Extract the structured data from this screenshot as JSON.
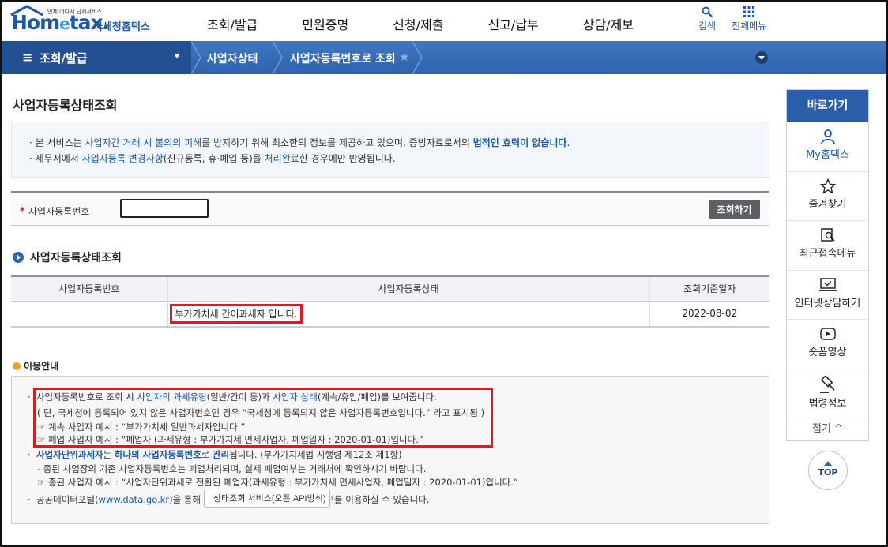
{
  "header": {
    "logo_tagline": "언제 어디서 납세서비스",
    "logo_brand_a": "Hom",
    "logo_brand_e": "e",
    "logo_brand_b": "tax.",
    "logo_korean": "국세청홈택스",
    "gnb": [
      "조회/발급",
      "민원증명",
      "신청/제출",
      "신고/납부",
      "상담/제보"
    ],
    "search_label": "검색",
    "allmenu_label": "전체메뉴"
  },
  "navbar": {
    "menu_glyph": "≡",
    "first": "조회/발급",
    "crumb1": "사업자상태",
    "crumb2": "사업자등록번호로 조회",
    "star": "★"
  },
  "page_title": "사업자등록상태조회",
  "notice": {
    "line1": {
      "a": "본 서비스는 ",
      "b": "사업자간 거래 시 불의의 피해",
      "c": "를 ",
      "d": "방지",
      "e": "하기 위해 최소한의 정보를 제공하고 있으며, 증빙자료로서의 ",
      "f": "법적인 효력이 없습니다",
      "g": "."
    },
    "line2": {
      "a": "세무서에서 ",
      "b": "사업자등록 변경사항",
      "c": "(신규등록, 휴·폐업 등)을 ",
      "d": "처리완료",
      "e": "한 경우에만 반영됩니다."
    }
  },
  "search": {
    "required_mark": "*",
    "label": "사업자등록번호",
    "value": "",
    "button": "조회하기"
  },
  "result_section_title": "사업자등록상태조회",
  "result_table": {
    "headers": [
      "사업자등록번호",
      "사업자등록상태",
      "조회기준일자"
    ],
    "rows": [
      {
        "number": "",
        "status": "부가가치세 간이과세자 입니다.",
        "date": "2022-08-02"
      }
    ]
  },
  "guide": {
    "title": "이용안내",
    "bullet1": {
      "a": "사업자등록번호로 조회 시 ",
      "b": "사업자의 과세유형",
      "c": "(일반/간이 등)과 ",
      "d": "사업자 상태",
      "e": "(계속/휴업/폐업)를 보여줍니다."
    },
    "line2": "( 단, 국세청에 등록되어 있지 않은 사업자번호인 경우 “국세청에 등록되지 않은 사업자등록번호입니다.” 라고 표시됨 )",
    "line3": "☞ 계속 사업자 예시 : “부가가치세 일반과세자입니다.”",
    "line4": "☞ 폐업 사업자 예시 : “폐업자 (과세유형 : 부가가치세 면세사업자, 폐업일자 : 2020-01-01)입니다.”",
    "bullet2": {
      "a": "사업자단위과세자",
      "b": "는 ",
      "c": "하나의 사업자등록번호",
      "d": "로 ",
      "e": "관리",
      "f": "됩니다. (부가가치세법 시행령 제12조 제1항)"
    },
    "line6": "- 종된 사업장의 기존 사업자등록번호는 폐업처리되며, 실제 폐업여부는 거래처에 확인하시기 바랍니다.",
    "line7": "☞ 종된 사업자 예시 : “사업자단위과세로 전환된 폐업자(과세유형 : 부가가치세 면세사업자, 폐업일자 : 2020-01-01)입니다.”",
    "bullet3": {
      "a": "공공데이터포털(",
      "link": "www.data.go.kr",
      "b": ")을 통해",
      "button": "상태조회 서비스(오픈 API방식)",
      "chev": "›",
      "c": "를 이용하실 수 있습니다."
    }
  },
  "quick": {
    "title": "바로가기",
    "items": [
      "My홈택스",
      "즐겨찾기",
      "최근접속메뉴",
      "인터넷상담하기",
      "숏폼영상",
      "법령정보"
    ],
    "fold": "접기 ^",
    "top": "TOP"
  },
  "colors": {
    "brand": "#1a5aa8",
    "navbar": "#2d63ad",
    "highlight": "#e8161b"
  }
}
